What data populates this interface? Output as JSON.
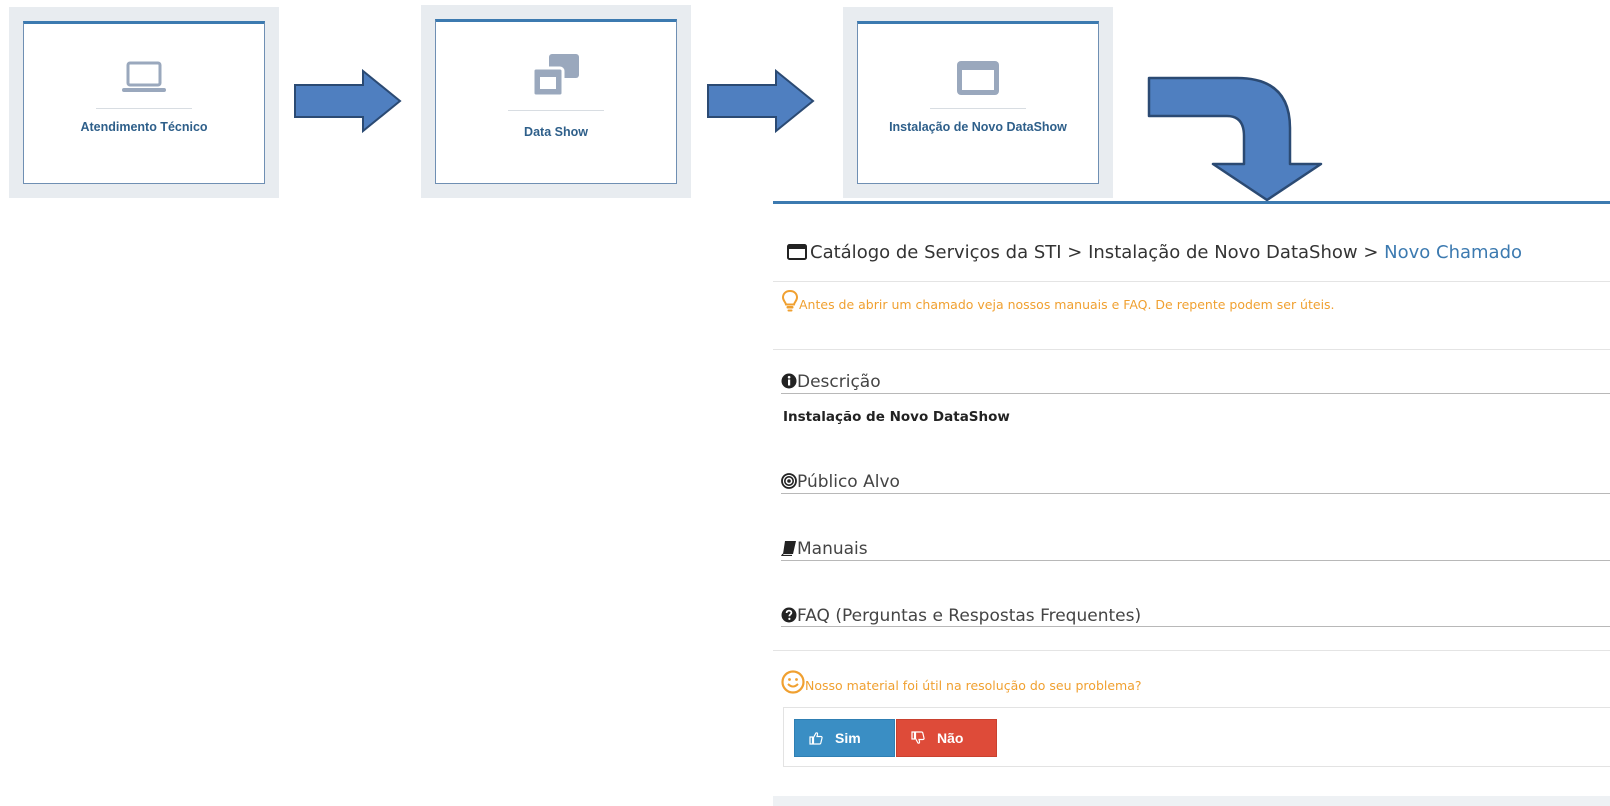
{
  "cards": [
    {
      "label": "Atendimento Técnico",
      "icon": "laptop-icon"
    },
    {
      "label": "Data Show",
      "icon": "clone-icon"
    },
    {
      "label": "Instalação de Novo DataShow",
      "icon": "window-icon"
    }
  ],
  "panel": {
    "breadcrumb": {
      "part1": "Catálogo de Serviços da STI",
      "sep1": " > ",
      "part2": "Instalação de Novo DataShow",
      "sep2": " > ",
      "current": "Novo Chamado"
    },
    "tip": "Antes de abrir um chamado veja nossos manuais e FAQ. De repente podem ser úteis.",
    "sections": {
      "descricao": "Descrição",
      "descricao_text": "Instalação de Novo DataShow",
      "publico": "Público Alvo",
      "manuais": "Manuais",
      "faq": "FAQ (Perguntas e Respostas Frequentes)"
    },
    "feedback": {
      "question": "Nosso material foi útil na resolução do seu problema?",
      "yes": "Sim",
      "no": "Não"
    }
  },
  "colors": {
    "accent": "#3c7ab0",
    "arrow": "#4f7fc0",
    "warning": "#f0a030",
    "yes": "#3a8ec4",
    "no": "#de4b39"
  }
}
